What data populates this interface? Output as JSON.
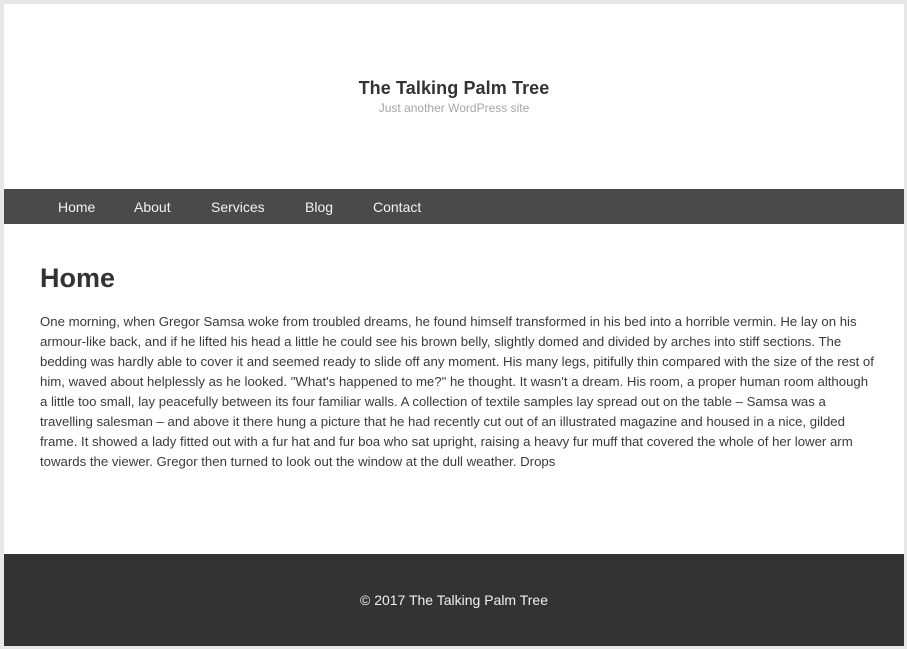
{
  "header": {
    "site_title": "The Talking Palm Tree",
    "tagline": "Just another WordPress site"
  },
  "nav": {
    "items": [
      {
        "label": "Home"
      },
      {
        "label": "About"
      },
      {
        "label": "Services"
      },
      {
        "label": "Blog"
      },
      {
        "label": "Contact"
      }
    ]
  },
  "main": {
    "page_title": "Home",
    "body": "One morning, when Gregor Samsa woke from troubled dreams, he found himself transformed in his bed into a horrible vermin. He lay on his armour-like back, and if he lifted his head a little he could see his brown belly, slightly domed and divided by arches into stiff sections. The bedding was hardly able to cover it and seemed ready to slide off any moment. His many legs, pitifully thin compared with the size of the rest of him, waved about helplessly as he looked. \"What's happened to me?\" he thought. It wasn't a dream. His room, a proper human room although a little too small, lay peacefully between its four familiar walls. A collection of textile samples lay spread out on the table – Samsa was a travelling salesman – and above it there hung a picture that he had recently cut out of an illustrated magazine and housed in a nice, gilded frame. It showed a lady fitted out with a fur hat and fur boa who sat upright, raising a heavy fur muff that covered the whole of her lower arm towards the viewer. Gregor then turned to look out the window at the dull weather. Drops"
  },
  "footer": {
    "copyright": "© 2017 The Talking Palm Tree"
  },
  "colors": {
    "nav_background": "#4a4a4a",
    "footer_background": "#333333",
    "page_background": "#ffffff",
    "tagline": "#a6a6a6"
  }
}
